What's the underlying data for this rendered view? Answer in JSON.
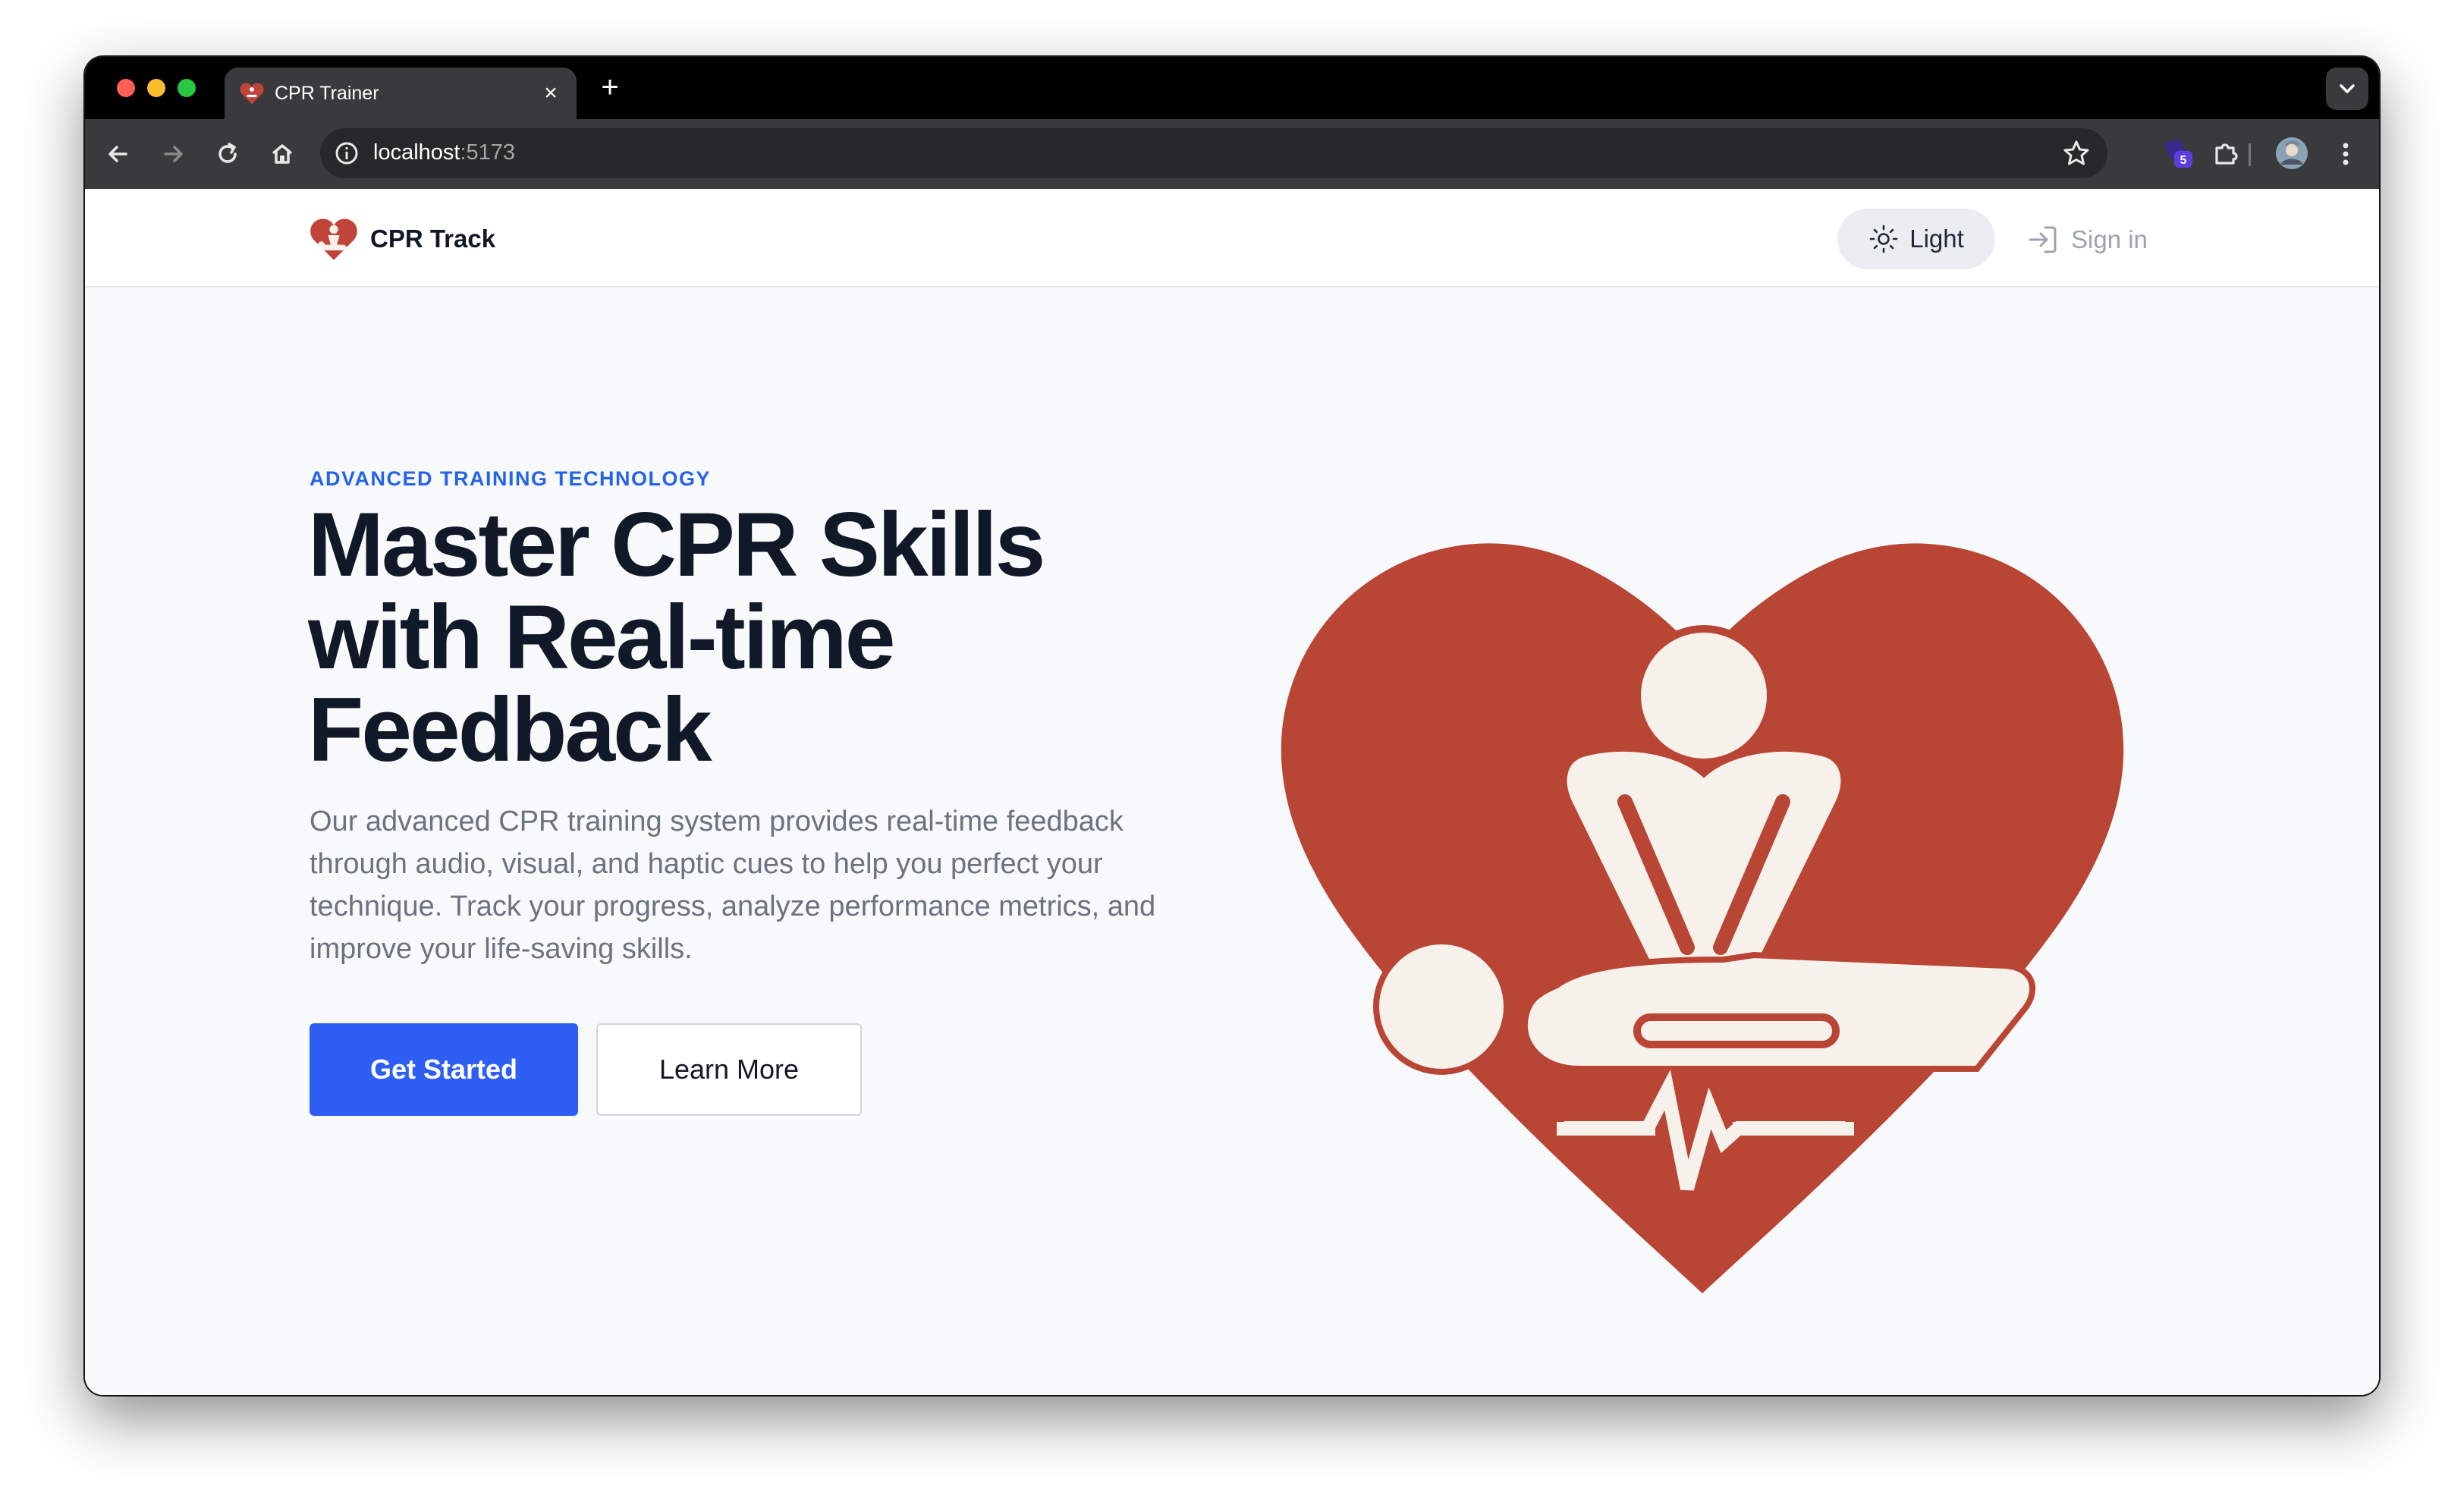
{
  "browser": {
    "tab_title": "CPR Trainer",
    "url_host": "localhost",
    "url_port": ":5173",
    "extension_badge": "5"
  },
  "navbar": {
    "brand_name": "CPR Track",
    "theme_label": "Light",
    "signin_label": "Sign in"
  },
  "hero": {
    "eyebrow": "ADVANCED TRAINING TECHNOLOGY",
    "headline_line1": "Master CPR Skills",
    "headline_line2": "with Real-time",
    "headline_line3": "Feedback",
    "description": "Our advanced CPR training system provides real-time feedback through audio, visual, and haptic cues to help you perfect your technique. Track your progress, analyze performance metrics, and improve your life-saving skills.",
    "primary_cta": "Get Started",
    "secondary_cta": "Learn More"
  },
  "colors": {
    "accent": "#2f5ef5",
    "eyebrow": "#2563eb",
    "heart_red": "#b94535",
    "figure_cream": "#f7f1ec"
  },
  "icons": [
    "back-arrow-icon",
    "forward-arrow-icon",
    "reload-icon",
    "home-icon",
    "info-icon",
    "star-icon",
    "extensions-icon",
    "profile-avatar",
    "kebab-menu-icon",
    "sun-icon",
    "sign-in-icon",
    "cpr-heart-logo"
  ]
}
